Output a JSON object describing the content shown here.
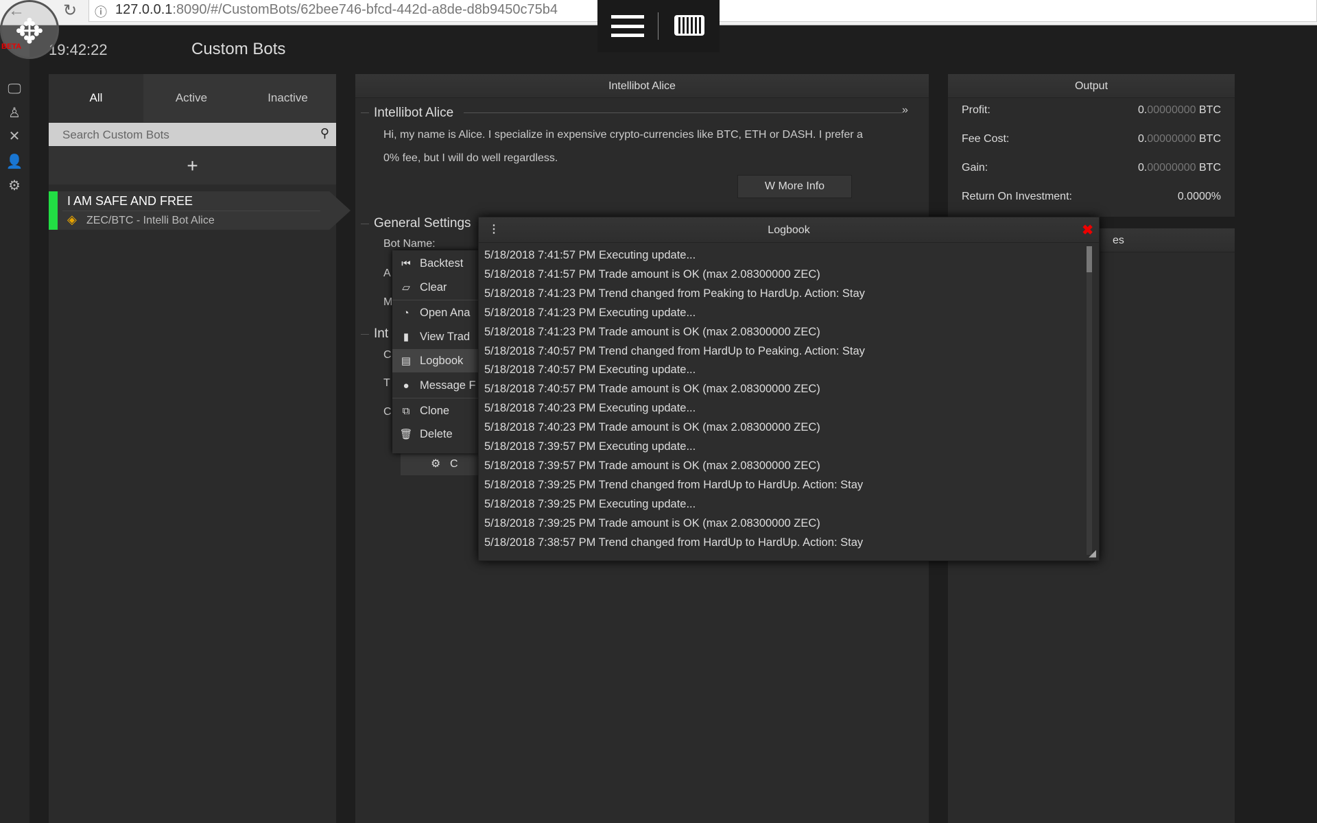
{
  "browser": {
    "url_host": "127.0.0.1",
    "url_rest": ":8090/#/CustomBots/62bee746-bfcd-442d-a8de-d8b9450c75b4"
  },
  "header": {
    "time": "19:42:22",
    "title": "Custom Bots",
    "beta": "BETA"
  },
  "left": {
    "tabs": [
      "All",
      "Active",
      "Inactive"
    ],
    "active_tab": "All",
    "search_placeholder": "Search Custom Bots",
    "add": "+",
    "bots": [
      {
        "name": "I AM SAFE AND FREE",
        "subtitle": "ZEC/BTC - Intelli Bot Alice",
        "status_color": "#22dd44"
      }
    ]
  },
  "middle": {
    "header": "Intellibot Alice",
    "section": "Intellibot Alice",
    "description_1": "Hi, my name is Alice. I specialize in expensive crypto-currencies like BTC, ETH or DASH. I prefer a",
    "description_2": "0% fee, but I will do well regardless.",
    "more_info": "More Info",
    "general_settings": "General Settings",
    "bot_name_label": "Bot Name:",
    "label_a": "A",
    "label_m": "M",
    "int_section": "Int",
    "label_c1": "C",
    "label_t": "T",
    "label_c2": "C",
    "button_partial": "C"
  },
  "context_menu": {
    "items": [
      "Backtest",
      "Clear",
      "Open Ana",
      "View Trad",
      "Logbook",
      "Message F",
      "Clone",
      "Delete"
    ],
    "selected": "Logbook"
  },
  "logbook": {
    "title": "Logbook",
    "entries": [
      "5/18/2018 7:41:57 PM Executing update...",
      "5/18/2018 7:41:57 PM Trade amount is OK (max 2.08300000 ZEC)",
      "5/18/2018 7:41:23 PM Trend changed from Peaking to HardUp. Action: Stay",
      "5/18/2018 7:41:23 PM Executing update...",
      "5/18/2018 7:41:23 PM Trade amount is OK (max 2.08300000 ZEC)",
      "5/18/2018 7:40:57 PM Trend changed from HardUp to Peaking. Action: Stay",
      "5/18/2018 7:40:57 PM Executing update...",
      "5/18/2018 7:40:57 PM Trade amount is OK (max 2.08300000 ZEC)",
      "5/18/2018 7:40:23 PM Executing update...",
      "5/18/2018 7:40:23 PM Trade amount is OK (max 2.08300000 ZEC)",
      "5/18/2018 7:39:57 PM Executing update...",
      "5/18/2018 7:39:57 PM Trade amount is OK (max 2.08300000 ZEC)",
      "5/18/2018 7:39:25 PM Trend changed from HardUp to HardUp. Action: Stay",
      "5/18/2018 7:39:25 PM Executing update...",
      "5/18/2018 7:39:25 PM Trade amount is OK (max 2.08300000 ZEC)",
      "5/18/2018 7:38:57 PM Trend changed from HardUp to HardUp. Action: Stay"
    ]
  },
  "output": {
    "header": "Output",
    "rows": [
      {
        "label": "Profit:",
        "int": "0.",
        "frac": "00000000",
        "unit": "BTC"
      },
      {
        "label": "Fee Cost:",
        "int": "0.",
        "frac": "00000000",
        "unit": "BTC"
      },
      {
        "label": "Gain:",
        "int": "0.",
        "frac": "00000000",
        "unit": "BTC"
      }
    ],
    "roi_label": "Return On Investment:",
    "roi": "0.0000%"
  },
  "second_panel": {
    "header_partial": "es"
  }
}
